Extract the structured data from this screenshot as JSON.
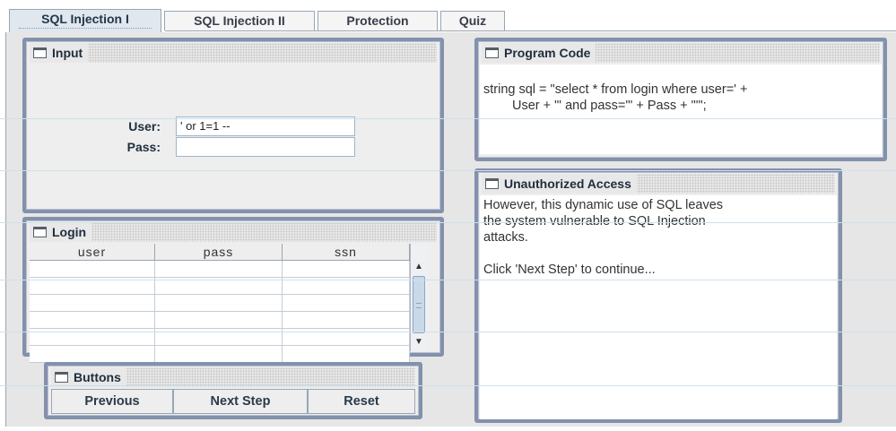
{
  "tabs": [
    {
      "label": "SQL Injection I",
      "active": true
    },
    {
      "label": "SQL Injection II",
      "active": false
    },
    {
      "label": "Protection",
      "active": false
    },
    {
      "label": "Quiz",
      "active": false
    }
  ],
  "input_panel": {
    "title": "Input",
    "user_label": "User:",
    "user_value": "' or 1=1 --",
    "pass_label": "Pass:",
    "pass_value": ""
  },
  "login_panel": {
    "title": "Login",
    "columns": [
      "user",
      "pass",
      "ssn"
    ]
  },
  "buttons_panel": {
    "title": "Buttons",
    "previous_label": "Previous",
    "next_label": "Next Step",
    "reset_label": "Reset"
  },
  "code_panel": {
    "title": "Program Code",
    "line1": "string sql = \"select * from login where user=' +",
    "line2": "User + \"' and pass='\" + Pass  + \"'\";"
  },
  "unauthorized_panel": {
    "title": "Unauthorized Access",
    "line1": "However, this dynamic use of SQL leaves",
    "line2": "the system vulnerable to SQL Injection",
    "line3": "attacks.",
    "line4": "Click 'Next Step' to continue..."
  },
  "colors": {
    "panel_border": "#8391ad",
    "panel_bg": "#eeeeee",
    "active_tab": "#e0e7ef",
    "window_bg": "#e6e6e6"
  }
}
